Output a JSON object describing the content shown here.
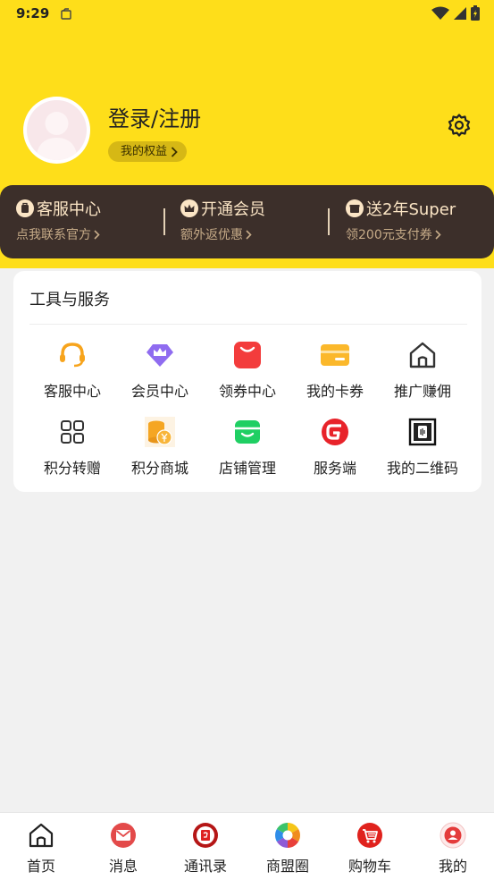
{
  "status_bar": {
    "time": "9:29"
  },
  "profile": {
    "login_label": "登录/注册",
    "benefits_label": "我的权益"
  },
  "member_bar": {
    "items": [
      {
        "title": "客服中心",
        "subtitle": "点我联系官方"
      },
      {
        "title": "开通会员",
        "subtitle": "额外返优惠"
      },
      {
        "title": "送2年Super",
        "subtitle": "领200元支付券"
      }
    ]
  },
  "tools": {
    "title": "工具与服务",
    "items": [
      {
        "label": "客服中心",
        "icon": "headset-icon"
      },
      {
        "label": "会员中心",
        "icon": "crown-shield-icon"
      },
      {
        "label": "领券中心",
        "icon": "coupon-bag-icon"
      },
      {
        "label": "我的卡券",
        "icon": "card-icon"
      },
      {
        "label": "推广赚佣",
        "icon": "home-outline-icon"
      },
      {
        "label": "积分转赠",
        "icon": "grid-icon"
      },
      {
        "label": "积分商城",
        "icon": "coin-stack-icon"
      },
      {
        "label": "店铺管理",
        "icon": "shop-icon"
      },
      {
        "label": "服务端",
        "icon": "service-logo-icon"
      },
      {
        "label": "我的二维码",
        "icon": "qr-code-icon"
      }
    ]
  },
  "bottom_nav": {
    "items": [
      {
        "label": "首页",
        "icon": "home-icon"
      },
      {
        "label": "消息",
        "icon": "mail-icon"
      },
      {
        "label": "通讯录",
        "icon": "contacts-icon"
      },
      {
        "label": "商盟圈",
        "icon": "camera-aperture-icon"
      },
      {
        "label": "购物车",
        "icon": "cart-icon"
      },
      {
        "label": "我的",
        "icon": "person-icon"
      }
    ]
  },
  "colors": {
    "header_yellow": "#fede1a",
    "member_bar_bg": "#3c2f2a",
    "member_text": "#fbe5c5",
    "page_bg": "#f1f1f1"
  }
}
